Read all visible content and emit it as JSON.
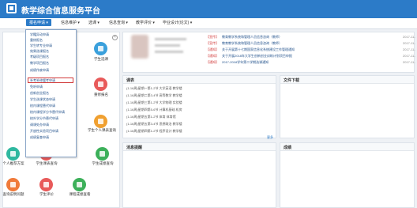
{
  "header": {
    "title": "教学综合信息服务平台"
  },
  "navbar": {
    "items": [
      "报名申请 ▾",
      "信息维护 ▾",
      "选课 ▾",
      "信息查询 ▾",
      "教学评价 ▾",
      "毕业设计(论文) ▾"
    ]
  },
  "dropdown": {
    "items": [
      "学籍异动申请",
      "重修报名",
      "学生转专业申请",
      "效果选课报名",
      "考级项目报名",
      "教学项目报名",
      "成绩作废申请",
      "补考补修缓考申请",
      "免听申请",
      "创新创业报名",
      "学生选课状态申请",
      "校内课程替代申请",
      "校内课程学分节替代申请",
      "校外学分节替代申请",
      "调课处办申请",
      "开放性实验项目申请",
      "成绩复查申请"
    ],
    "highlighted": "补考补修缓考申请"
  },
  "apps": [
    {
      "label": "学生选课",
      "color": "#3aa0dc"
    },
    {
      "label": "重修报名",
      "color": "#e85a5a"
    },
    {
      "label": "学生个人课表查询",
      "color": "#f0a030"
    },
    {
      "label": "个人推荐方案",
      "color": "#2fb8a0"
    },
    {
      "label": "学生课表查询",
      "color": "#e85a5a"
    },
    {
      "label": "学生成绩查询",
      "color": "#3cb05a"
    },
    {
      "label": "查询说明问题",
      "color": "#f07a3a"
    },
    {
      "label": "学生评价",
      "color": "#e85a5a"
    },
    {
      "label": "课程成绩查看",
      "color": "#3cb05a"
    }
  ],
  "notices": [
    {
      "badge": "【宣传】",
      "text": "教育教学系统和管理人员信息咨询（教师）",
      "date": "2017-11-"
    },
    {
      "badge": "【宣传】",
      "text": "教育教学系统和管理人员信息咨询（教师）",
      "date": "2017-11-"
    },
    {
      "badge": "【通知】",
      "text": "关于开展第十七期国家信息化系统建设工作管理通知",
      "date": "2017-11-"
    },
    {
      "badge": "【通知】",
      "text": "关于开展2018年大学生创新创业训练计划项目申报",
      "date": "2017-11-"
    },
    {
      "badge": "【通知】",
      "text": "2017-2018学年第二学期选课通知",
      "date": "2017-11-"
    }
  ],
  "panels": {
    "courses": "课表",
    "files": "文件下载",
    "messages": "消息提醒",
    "grades": "成绩"
  },
  "courses": [
    "(1-16周)星期一第1-2节 大学英语 教学楼",
    "(1-16周)星期二第3-4节 高等数学 教学楼",
    "(1-16周)星期三第1-2节 大学物理 实验楼",
    "(1-16周)星期四第5-6节 计算机基础 机房",
    "(1-16周)星期五第1-2节 体育 体育馆",
    "(1-16周)星期五第3-4节 思想政治 教学楼",
    "(1-16周)星期四第1-2节 程序设计 教学楼"
  ],
  "more": "更多"
}
